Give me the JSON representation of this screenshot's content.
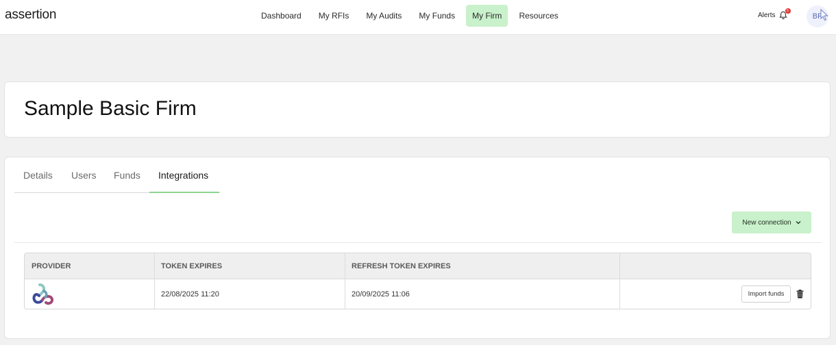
{
  "app": {
    "logo": "assertion"
  },
  "nav": {
    "items": [
      {
        "label": "Dashboard",
        "active": false
      },
      {
        "label": "My RFIs",
        "active": false
      },
      {
        "label": "My Audits",
        "active": false
      },
      {
        "label": "My Funds",
        "active": false
      },
      {
        "label": "My Firm",
        "active": true
      },
      {
        "label": "Resources",
        "active": false
      }
    ]
  },
  "header": {
    "alerts_label": "Alerts",
    "alerts_count": "5",
    "avatar_initials": "BP"
  },
  "firm": {
    "name": "Sample Basic Firm"
  },
  "tabs": [
    {
      "label": "Details",
      "active": false
    },
    {
      "label": "Users",
      "active": false
    },
    {
      "label": "Funds",
      "active": false
    },
    {
      "label": "Integrations",
      "active": true
    }
  ],
  "actions": {
    "new_connection_label": "New connection"
  },
  "table": {
    "columns": [
      "PROVIDER",
      "TOKEN EXPIRES",
      "REFRESH TOKEN EXPIRES",
      ""
    ],
    "rows": [
      {
        "provider_icon": "provider-logo-icon",
        "token_expires": "22/08/2025 11:20",
        "refresh_token_expires": "20/09/2025 11:06",
        "import_label": "Import funds"
      }
    ]
  },
  "colors": {
    "accent_green": "#c9f1cb",
    "tab_underline": "#8ed490",
    "badge_red": "#e53935"
  }
}
